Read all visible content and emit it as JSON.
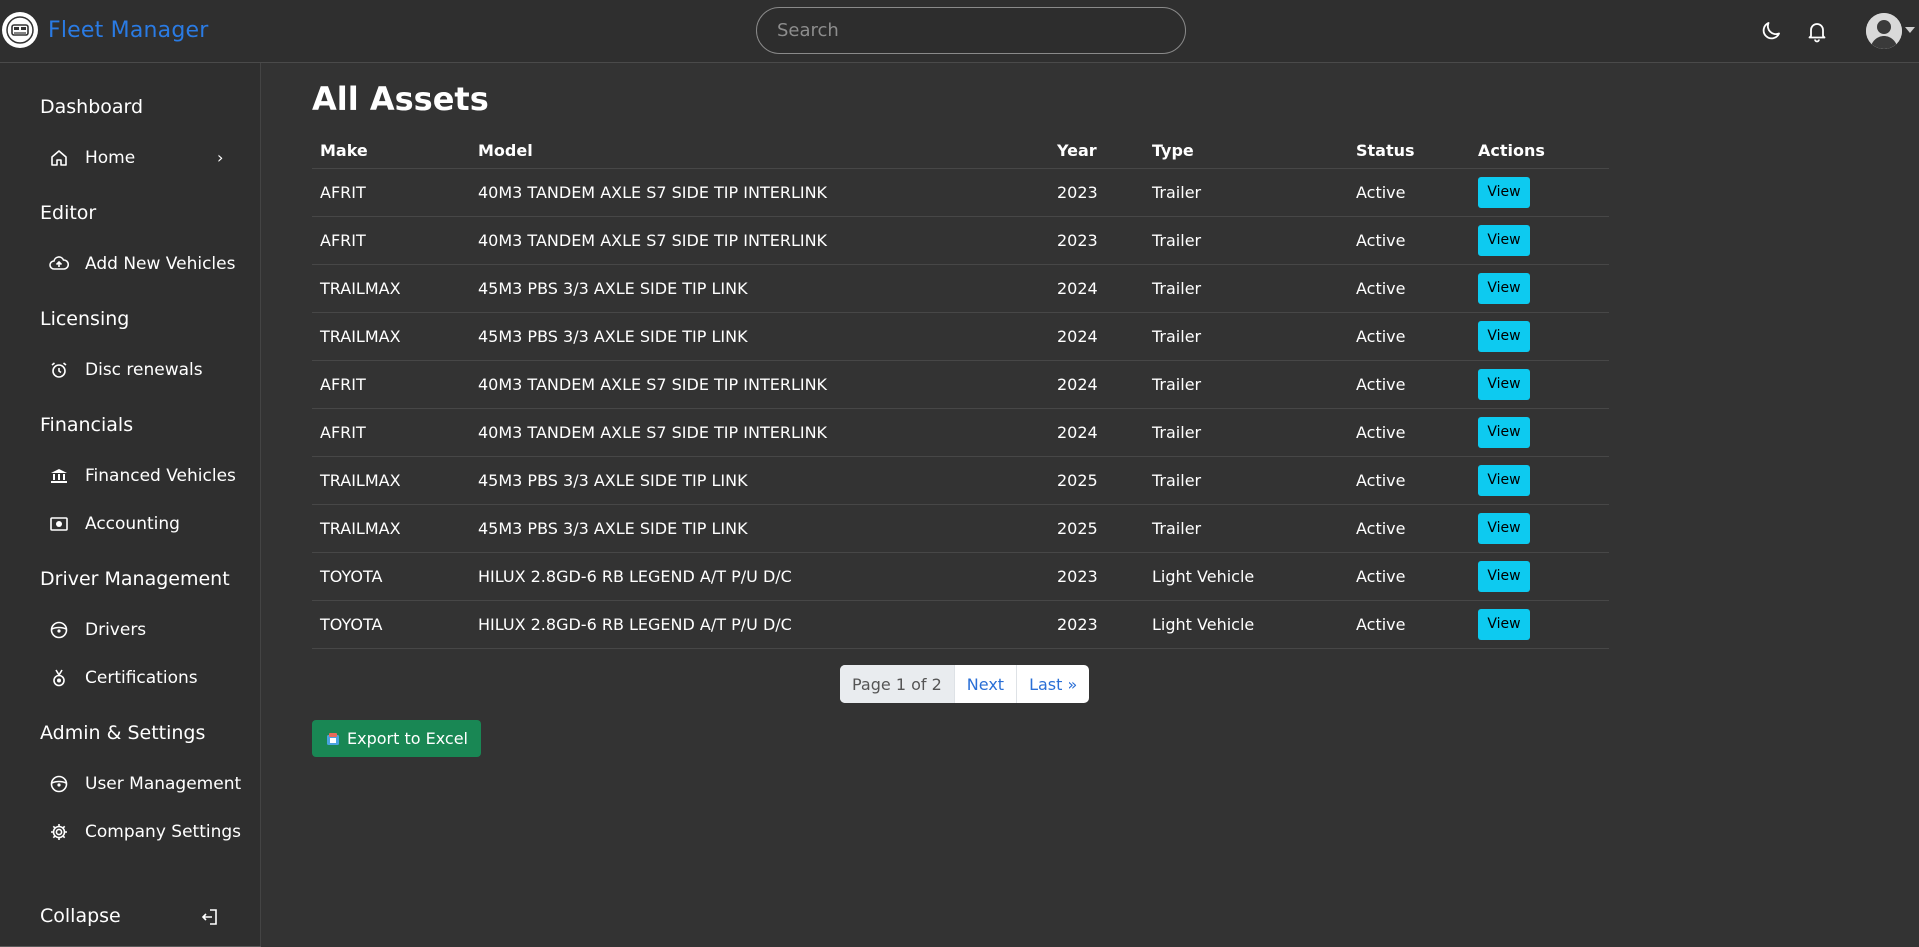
{
  "app": {
    "title": "Fleet Manager"
  },
  "search": {
    "placeholder": "Search"
  },
  "topbar": {
    "icons": [
      "moon-icon",
      "bell-icon",
      "user-avatar"
    ]
  },
  "sidebar": {
    "sections": [
      {
        "title": "Dashboard",
        "items": [
          {
            "label": "Home",
            "icon": "home-icon",
            "chevron": "›"
          }
        ]
      },
      {
        "title": "Editor",
        "items": [
          {
            "label": "Add New Vehicles",
            "icon": "cloud-upload-icon"
          }
        ]
      },
      {
        "title": "Licensing",
        "items": [
          {
            "label": "Disc renewals",
            "icon": "alarm-clock-icon"
          }
        ]
      },
      {
        "title": "Financials",
        "items": [
          {
            "label": "Financed Vehicles",
            "icon": "bank-icon"
          },
          {
            "label": "Accounting",
            "icon": "cash-icon"
          }
        ]
      },
      {
        "title": "Driver Management",
        "items": [
          {
            "label": "Drivers",
            "icon": "steering-wheel-icon"
          },
          {
            "label": "Certifications",
            "icon": "medal-icon"
          }
        ]
      },
      {
        "title": "Admin & Settings",
        "items": [
          {
            "label": "User Management",
            "icon": "steering-wheel-icon"
          },
          {
            "label": "Company Settings",
            "icon": "gear-icon"
          }
        ]
      }
    ],
    "collapse_label": "Collapse"
  },
  "main": {
    "title": "All Assets",
    "columns": [
      "Make",
      "Model",
      "Year",
      "Type",
      "Status",
      "Actions"
    ],
    "view_label": "View",
    "rows": [
      {
        "make": "AFRIT",
        "model": "40M3 TANDEM AXLE S7 SIDE TIP INTERLINK",
        "year": "2023",
        "type": "Trailer",
        "status": "Active"
      },
      {
        "make": "AFRIT",
        "model": "40M3 TANDEM AXLE S7 SIDE TIP INTERLINK",
        "year": "2023",
        "type": "Trailer",
        "status": "Active"
      },
      {
        "make": "TRAILMAX",
        "model": "45M3 PBS 3/3 AXLE SIDE TIP LINK",
        "year": "2024",
        "type": "Trailer",
        "status": "Active"
      },
      {
        "make": "TRAILMAX",
        "model": "45M3 PBS 3/3 AXLE SIDE TIP LINK",
        "year": "2024",
        "type": "Trailer",
        "status": "Active"
      },
      {
        "make": "AFRIT",
        "model": "40M3 TANDEM AXLE S7 SIDE TIP INTERLINK",
        "year": "2024",
        "type": "Trailer",
        "status": "Active"
      },
      {
        "make": "AFRIT",
        "model": "40M3 TANDEM AXLE S7 SIDE TIP INTERLINK",
        "year": "2024",
        "type": "Trailer",
        "status": "Active"
      },
      {
        "make": "TRAILMAX",
        "model": "45M3 PBS 3/3 AXLE SIDE TIP LINK",
        "year": "2025",
        "type": "Trailer",
        "status": "Active"
      },
      {
        "make": "TRAILMAX",
        "model": "45M3 PBS 3/3 AXLE SIDE TIP LINK",
        "year": "2025",
        "type": "Trailer",
        "status": "Active"
      },
      {
        "make": "TOYOTA",
        "model": "HILUX 2.8GD-6 RB LEGEND A/T P/U D/C",
        "year": "2023",
        "type": "Light Vehicle",
        "status": "Active"
      },
      {
        "make": "TOYOTA",
        "model": "HILUX 2.8GD-6 RB LEGEND A/T P/U D/C",
        "year": "2023",
        "type": "Light Vehicle",
        "status": "Active"
      }
    ],
    "pagination": {
      "info": "Page 1 of 2",
      "next": "Next",
      "last": "Last »"
    },
    "export_label": "Export to Excel"
  },
  "colors": {
    "brand": "#2a7be4",
    "view_button": "#0dcaf0",
    "export_button": "#198754",
    "background": "#333333"
  }
}
